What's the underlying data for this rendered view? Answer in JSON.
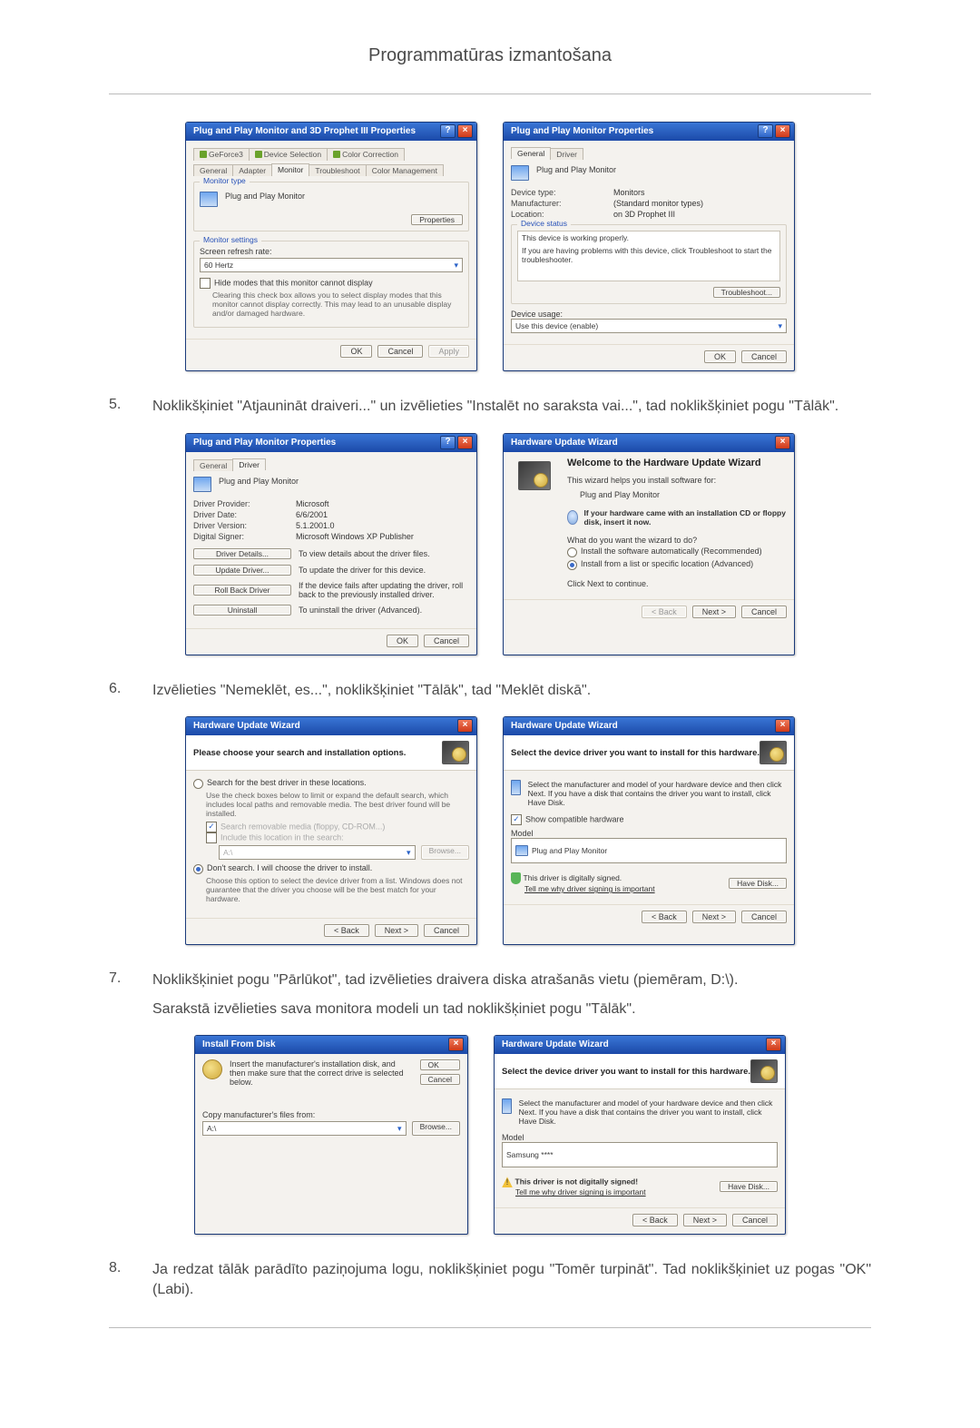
{
  "page_title": "Programmatūras izmantošana",
  "steps": {
    "s5": {
      "num": "5.",
      "text": "Noklikšķiniet \"Atjaunināt draiveri...\" un izvēlieties \"Instalēt no saraksta vai...\", tad noklikšķiniet pogu \"Tālāk\"."
    },
    "s6": {
      "num": "6.",
      "text": "Izvēlieties \"Nemeklēt, es...\", noklikšķiniet \"Tālāk\", tad \"Meklēt diskā\"."
    },
    "s7": {
      "num": "7.",
      "text": "Noklikšķiniet pogu \"Pārlūkot\", tad izvēlieties draivera diska atrašanās vietu (piemēram, D:\\).",
      "sub": "Sarakstā izvēlieties sava monitora modeli un tad noklikšķiniet pogu \"Tālāk\"."
    },
    "s8": {
      "num": "8.",
      "text": "Ja redzat tālāk parādīto paziņojuma logu, noklikšķiniet pogu \"Tomēr turpināt\". Tad noklikšķiniet uz pogas \"OK\" (Labi)."
    }
  },
  "common": {
    "ok": "OK",
    "cancel": "Cancel",
    "apply": "Apply",
    "back": "< Back",
    "next": "Next >",
    "browse": "Browse...",
    "have_disk": "Have Disk...",
    "help_q": "?",
    "close_x": "×"
  },
  "d1": {
    "title": "Plug and Play Monitor and 3D Prophet III Properties",
    "tabs": {
      "geforce": "GeForce3",
      "devsel": "Device Selection",
      "colcorr": "Color Correction",
      "general": "General",
      "adapter": "Adapter",
      "monitor": "Monitor",
      "trouble": "Troubleshoot",
      "colmgmt": "Color Management"
    },
    "monitor_type_label": "Monitor type",
    "monitor_model": "Plug and Play Monitor",
    "properties_btn": "Properties",
    "mon_settings": "Monitor settings",
    "refresh_label": "Screen refresh rate:",
    "refresh_value": "60 Hertz",
    "hide_modes": "Hide modes that this monitor cannot display",
    "hide_modes_desc": "Clearing this check box allows you to select display modes that this monitor cannot display correctly. This may lead to an unusable display and/or damaged hardware."
  },
  "d2": {
    "title": "Plug and Play Monitor Properties",
    "tabs": {
      "general": "General",
      "driver": "Driver"
    },
    "device_name": "Plug and Play Monitor",
    "lbl_device_type": "Device type:",
    "val_device_type": "Monitors",
    "lbl_manuf": "Manufacturer:",
    "val_manuf": "(Standard monitor types)",
    "lbl_loc": "Location:",
    "val_loc": "on 3D Prophet III",
    "dev_status": "Device status",
    "status_text": "This device is working properly.",
    "status_help": "If you are having problems with this device, click Troubleshoot to start the troubleshooter.",
    "troubleshoot": "Troubleshoot...",
    "usage_lbl": "Device usage:",
    "usage_val": "Use this device (enable)"
  },
  "d3": {
    "title": "Plug and Play Monitor Properties",
    "tabs": {
      "general": "General",
      "driver": "Driver"
    },
    "device_name": "Plug and Play Monitor",
    "lbl_provider": "Driver Provider:",
    "val_provider": "Microsoft",
    "lbl_date": "Driver Date:",
    "val_date": "6/6/2001",
    "lbl_version": "Driver Version:",
    "val_version": "5.1.2001.0",
    "lbl_signer": "Digital Signer:",
    "val_signer": "Microsoft Windows XP Publisher",
    "btn_details": "Driver Details...",
    "desc_details": "To view details about the driver files.",
    "btn_update": "Update Driver...",
    "desc_update": "To update the driver for this device.",
    "btn_rollback": "Roll Back Driver",
    "desc_rollback": "If the device fails after updating the driver, roll back to the previously installed driver.",
    "btn_uninstall": "Uninstall",
    "desc_uninstall": "To uninstall the driver (Advanced)."
  },
  "d4": {
    "title": "Hardware Update Wizard",
    "welcome": "Welcome to the Hardware Update Wizard",
    "helps": "This wizard helps you install software for:",
    "device": "Plug and Play Monitor",
    "cd_hint": "If your hardware came with an installation CD or floppy disk, insert it now.",
    "what_do": "What do you want the wizard to do?",
    "opt_auto": "Install the software automatically (Recommended)",
    "opt_list": "Install from a list or specific location (Advanced)",
    "continue": "Click Next to continue."
  },
  "d5": {
    "title": "Hardware Update Wizard",
    "banner": "Please choose your search and installation options.",
    "opt_search": "Search for the best driver in these locations.",
    "opt_search_desc": "Use the check boxes below to limit or expand the default search, which includes local paths and removable media. The best driver found will be installed.",
    "chk_media": "Search removable media (floppy, CD-ROM...)",
    "chk_include": "Include this location in the search:",
    "loc_value": "A:\\",
    "opt_nosrch": "Don't search. I will choose the driver to install.",
    "opt_nosrch_desc": "Choose this option to select the device driver from a list. Windows does not guarantee that the driver you choose will be the best match for your hardware."
  },
  "d6": {
    "title": "Hardware Update Wizard",
    "banner": "Select the device driver you want to install for this hardware.",
    "desc": "Select the manufacturer and model of your hardware device and then click Next. If you have a disk that contains the driver you want to install, click Have Disk.",
    "show_compat": "Show compatible hardware",
    "model_lbl": "Model",
    "model_item": "Plug and Play Monitor",
    "signed": "This driver is digitally signed.",
    "signed_link": "Tell me why driver signing is important"
  },
  "d7": {
    "title": "Install From Disk",
    "desc": "Insert the manufacturer's installation disk, and then make sure that the correct drive is selected below.",
    "copy_from": "Copy manufacturer's files from:",
    "drive": "A:\\"
  },
  "d8": {
    "title": "Hardware Update Wizard",
    "banner": "Select the device driver you want to install for this hardware.",
    "desc": "Select the manufacturer and model of your hardware device and then click Next. If you have a disk that contains the driver you want to install, click Have Disk.",
    "model_lbl": "Model",
    "model_item": "Samsung ****",
    "unsigned": "This driver is not digitally signed!",
    "signed_link": "Tell me why driver signing is important"
  }
}
